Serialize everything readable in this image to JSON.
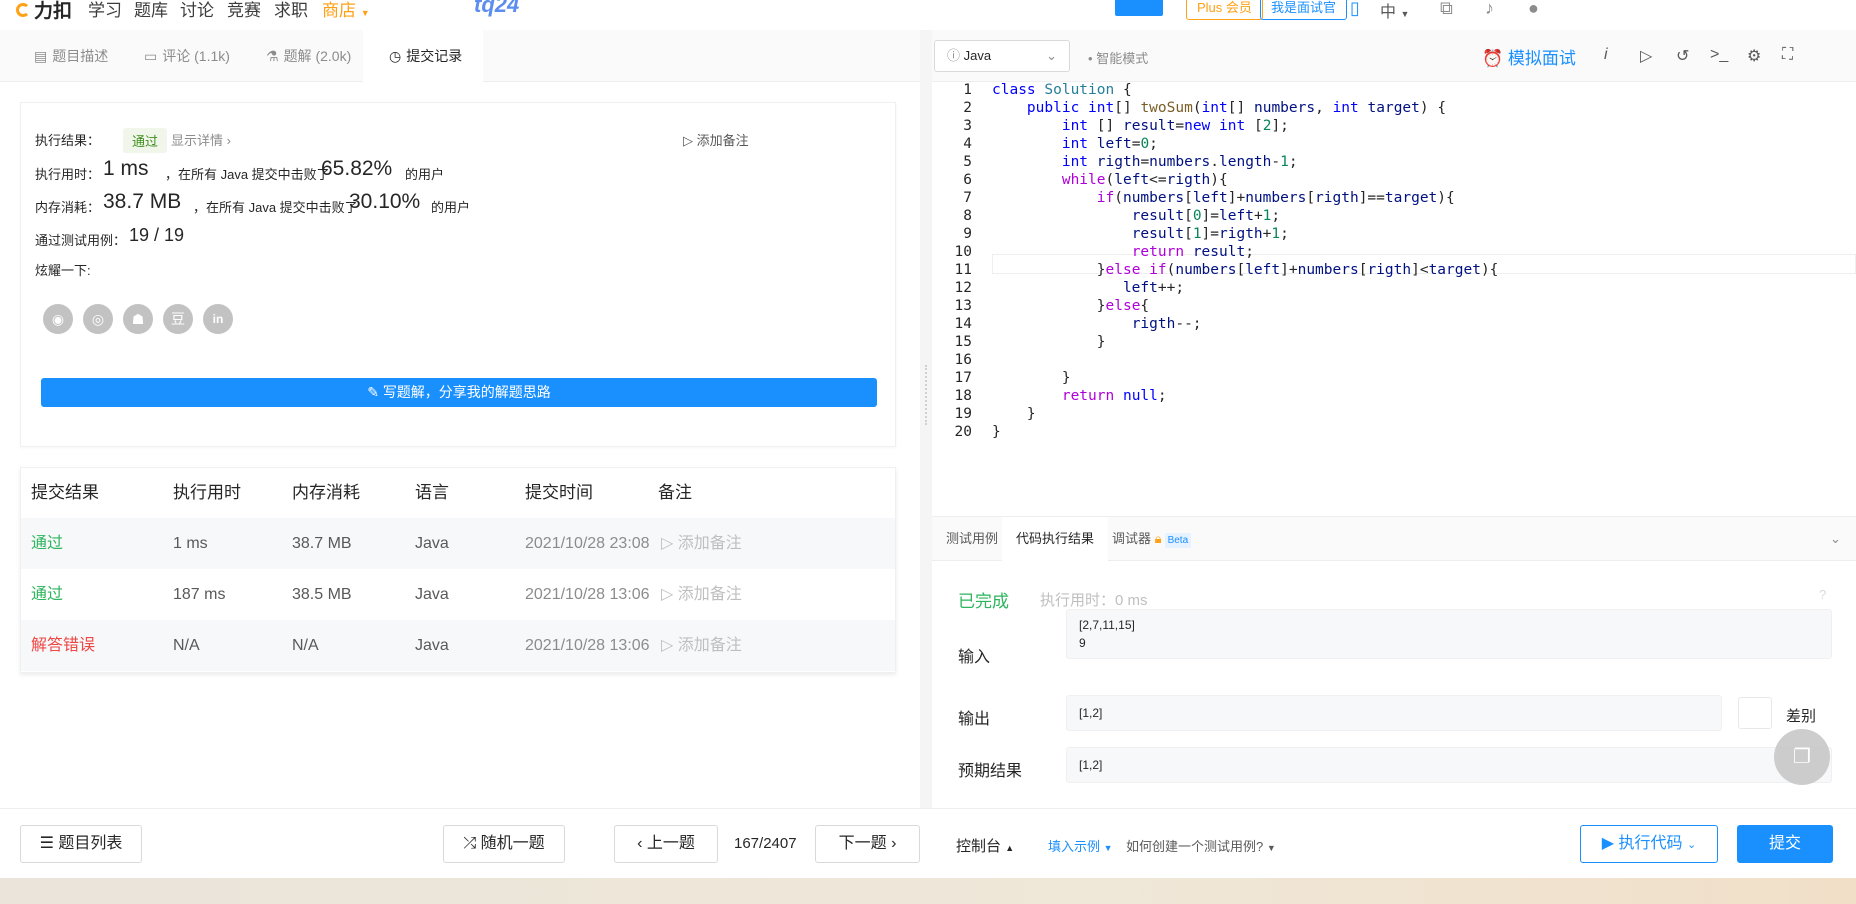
{
  "topnav": {
    "logo": "力扣",
    "items": [
      "学习",
      "题库",
      "讨论",
      "竞赛",
      "求职",
      "商店"
    ],
    "tq24": "tq24",
    "plus": "Plus 会员",
    "interviewer": "我是面试官",
    "lang": "中"
  },
  "left_tabs": [
    {
      "label": "题目描述",
      "icon": "document-icon"
    },
    {
      "label": "评论 (1.1k)",
      "icon": "comment-icon"
    },
    {
      "label": "题解 (2.0k)",
      "icon": "flask-icon"
    },
    {
      "label": "提交记录",
      "icon": "clock-icon"
    }
  ],
  "result": {
    "label": "执行结果：",
    "status": "通过",
    "details_link": "显示详情",
    "add_note": "添加备注",
    "time_label": "执行用时：",
    "time_value": "1 ms",
    "time_mid": "，在所有 Java 提交中击败了",
    "time_pct": "65.82%",
    "time_tail": "的用户",
    "mem_label": "内存消耗：",
    "mem_value": "38.7 MB",
    "mem_mid": "，在所有 Java 提交中击败了",
    "mem_pct": "30.10%",
    "mem_tail": "的用户",
    "tests_label": "通过测试用例：",
    "tests_value": "19 / 19",
    "share_label": "炫耀一下:",
    "share_icons": [
      "wechat-icon",
      "weibo-icon",
      "qq-icon",
      "douban-icon",
      "linkedin-icon"
    ],
    "write_solution": "写题解，分享我的解题思路"
  },
  "submissions": {
    "headers": [
      "提交结果",
      "执行用时",
      "内存消耗",
      "语言",
      "提交时间",
      "备注"
    ],
    "rows": [
      {
        "status": "通过",
        "time": "1 ms",
        "memory": "38.7 MB",
        "lang": "Java",
        "date": "2021/10/28 23:08",
        "note": "添加备注"
      },
      {
        "status": "通过",
        "time": "187 ms",
        "memory": "38.5 MB",
        "lang": "Java",
        "date": "2021/10/28 13:06",
        "note": "添加备注"
      },
      {
        "status": "解答错误",
        "time": "N/A",
        "memory": "N/A",
        "lang": "Java",
        "date": "2021/10/28 13:06",
        "note": "添加备注"
      }
    ]
  },
  "editor": {
    "language": "Java",
    "ai_mode": "智能模式",
    "mock_interview": "模拟面试",
    "line_numbers": [
      "1",
      "2",
      "3",
      "4",
      "5",
      "6",
      "7",
      "8",
      "9",
      "10",
      "11",
      "12",
      "13",
      "14",
      "15",
      "16",
      "17",
      "18",
      "19",
      "20"
    ]
  },
  "console": {
    "tabs": [
      "测试用例",
      "代码执行结果",
      "调试器"
    ],
    "beta": "Beta",
    "status": "已完成",
    "exec_time": "执行用时：0 ms",
    "input_label": "输入",
    "input_value": "[2,7,11,15]\n9",
    "output_label": "输出",
    "output_value": "[1,2]",
    "expected_label": "预期结果",
    "expected_value": "[1,2]",
    "diff_label": "差别"
  },
  "bottombar": {
    "problem_list": "题目列表",
    "random": "随机一题",
    "prev": "上一题",
    "page": "167/2407",
    "next": "下一题",
    "console": "控制台",
    "fill_example": "填入示例",
    "how_create": "如何创建一个测试用例?",
    "run": "执行代码",
    "submit": "提交"
  },
  "colors": {
    "accent": "#1a90ff",
    "success": "#2db55d",
    "error": "#ef4743",
    "brand": "#ffa116"
  }
}
